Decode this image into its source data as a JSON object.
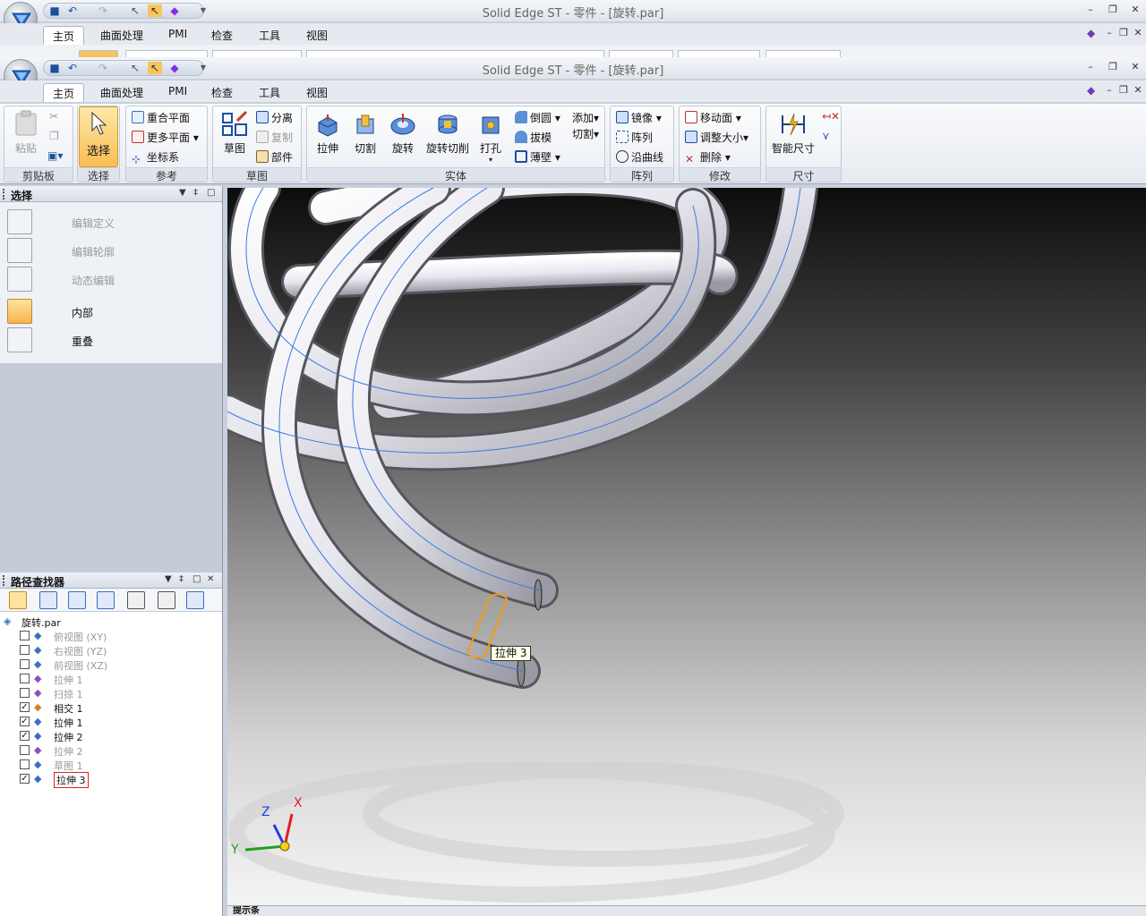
{
  "window": {
    "title": "Solid Edge ST - 零件 - [旋转.par]",
    "back_title": "Solid Edge ST - 零件 - [旋转.par]"
  },
  "tabs": [
    "主页",
    "曲面处理",
    "PMI",
    "检查",
    "工具",
    "视图"
  ],
  "ribbon": {
    "clipboard": {
      "paste": "粘贴",
      "label": "剪贴板"
    },
    "select": {
      "select": "选择",
      "label": "选择"
    },
    "reference": {
      "coincident_plane": "重合平面",
      "more_planes": "更多平面",
      "coord_system": "坐标系",
      "label": "参考"
    },
    "sketch": {
      "sketch": "草图",
      "separate": "分离",
      "copy": "复制",
      "part": "部件",
      "label": "草图"
    },
    "solids": {
      "extrude": "拉伸",
      "cut": "切割",
      "revolve": "旋转",
      "revolve_cut": "旋转切削",
      "hole": "打孔",
      "round": "倒圆",
      "draft": "拔模",
      "thin_wall": "薄壁",
      "add": "添加",
      "cut2": "切割",
      "label": "实体"
    },
    "pattern": {
      "mirror": "镜像",
      "pattern": "阵列",
      "along_curve": "沿曲线",
      "label": "阵列"
    },
    "modify": {
      "move_face": "移动面",
      "resize": "调整大小",
      "delete": "删除",
      "label": "修改"
    },
    "dimension": {
      "smart_dim": "智能尺寸",
      "label": "尺寸"
    }
  },
  "select_panel": {
    "title": "选择",
    "items": [
      {
        "label": "编辑定义",
        "enabled": false
      },
      {
        "label": "编辑轮廓",
        "enabled": false
      },
      {
        "label": "动态编辑",
        "enabled": false
      },
      {
        "label": "内部",
        "enabled": true
      },
      {
        "label": "重叠",
        "enabled": true
      }
    ]
  },
  "pathfinder": {
    "title": "路径查找器",
    "root": "旋转.par",
    "items": [
      {
        "label": "俯视图 (XY)",
        "checked": false,
        "dim": true
      },
      {
        "label": "右视图 (YZ)",
        "checked": false,
        "dim": true
      },
      {
        "label": "前视图 (XZ)",
        "checked": false,
        "dim": true
      },
      {
        "label": "拉伸 1",
        "checked": false,
        "dim": true
      },
      {
        "label": "扫掠 1",
        "checked": false,
        "dim": true
      },
      {
        "label": "相交 1",
        "checked": true,
        "dim": false
      },
      {
        "label": "拉伸 1",
        "checked": true,
        "dim": false
      },
      {
        "label": "拉伸 2",
        "checked": true,
        "dim": false
      },
      {
        "label": "拉伸 2",
        "checked": false,
        "dim": true
      },
      {
        "label": "草图 1",
        "checked": false,
        "dim": true
      },
      {
        "label": "拉伸 3",
        "checked": true,
        "dim": false,
        "selected": true
      }
    ]
  },
  "viewport": {
    "tooltip": "拉伸 3",
    "triad": {
      "x": "X",
      "y": "Y",
      "z": "Z"
    }
  },
  "status": {
    "label": "提示条"
  },
  "colors": {
    "accent": "#f8bd52",
    "selection": "#f39c12",
    "axis_x": "#e02020",
    "axis_y": "#20a020",
    "axis_z": "#2040e0"
  }
}
